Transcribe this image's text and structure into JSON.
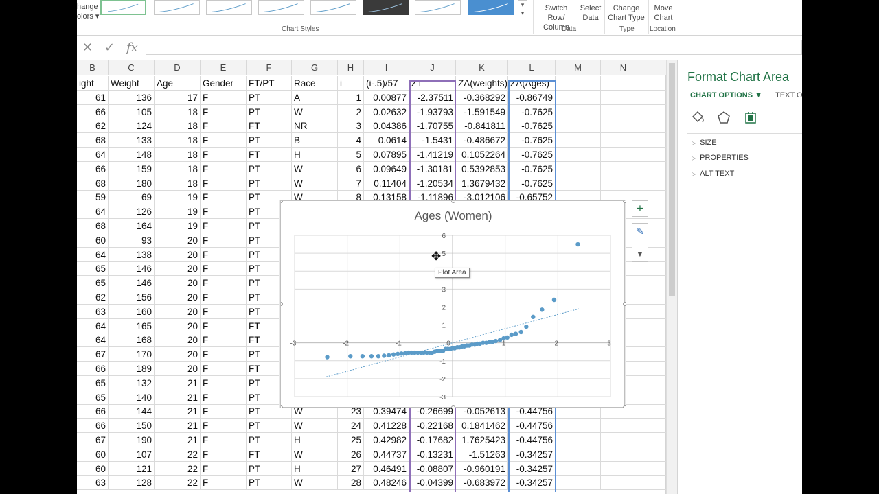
{
  "ribbon": {
    "change_colors_line1": "hange",
    "change_colors_line2": "olors ▾",
    "chart_styles_label": "Chart Styles",
    "switch_row_col": "Switch Row/\nColumn",
    "select_data": "Select\nData",
    "data_label": "Data",
    "change_chart_type": "Change\nChart Type",
    "type_label": "Type",
    "move_chart": "Move\nChart",
    "location_label": "Location"
  },
  "formula_bar": {
    "cancel_icon": "✕",
    "enter_icon": "✓",
    "fx_icon": "fx",
    "value": ""
  },
  "columns": [
    "B",
    "C",
    "D",
    "E",
    "F",
    "G",
    "H",
    "I",
    "J",
    "K",
    "L",
    "M",
    "N"
  ],
  "header_row": [
    "ight",
    "Weight",
    "Age",
    "Gender",
    "FT/PT",
    "Race",
    "i",
    "(i-.5)/57",
    "ZT",
    "ZA(weights)",
    "ZA(Ages)",
    "",
    ""
  ],
  "rows": [
    [
      "61",
      "136",
      "17",
      "F",
      "PT",
      "A",
      "1",
      "0.00877",
      "-2.37511",
      "-0.368292",
      "-0.86749"
    ],
    [
      "66",
      "105",
      "18",
      "F",
      "PT",
      "W",
      "2",
      "0.02632",
      "-1.93793",
      "-1.591549",
      "-0.7625"
    ],
    [
      "62",
      "124",
      "18",
      "F",
      "FT",
      "NR",
      "3",
      "0.04386",
      "-1.70755",
      "-0.841811",
      "-0.7625"
    ],
    [
      "68",
      "133",
      "18",
      "F",
      "PT",
      "B",
      "4",
      "0.0614",
      "-1.5431",
      "-0.486672",
      "-0.7625"
    ],
    [
      "64",
      "148",
      "18",
      "F",
      "FT",
      "H",
      "5",
      "0.07895",
      "-1.41219",
      "0.1052264",
      "-0.7625"
    ],
    [
      "66",
      "159",
      "18",
      "F",
      "PT",
      "W",
      "6",
      "0.09649",
      "-1.30181",
      "0.5392853",
      "-0.7625"
    ],
    [
      "68",
      "180",
      "18",
      "F",
      "PT",
      "W",
      "7",
      "0.11404",
      "-1.20534",
      "1.3679432",
      "-0.7625"
    ],
    [
      "59",
      "69",
      "19",
      "F",
      "PT",
      "W",
      "8",
      "0.13158",
      "-1.11896",
      "-3.012106",
      "-0.65752"
    ],
    [
      "64",
      "126",
      "19",
      "F",
      "PT",
      "",
      "",
      "",
      "",
      "",
      ""
    ],
    [
      "68",
      "164",
      "19",
      "F",
      "PT",
      "",
      "",
      "",
      "",
      "",
      ""
    ],
    [
      "60",
      "93",
      "20",
      "F",
      "PT",
      "",
      "",
      "",
      "",
      "",
      ""
    ],
    [
      "64",
      "138",
      "20",
      "F",
      "PT",
      "",
      "",
      "",
      "",
      "",
      ""
    ],
    [
      "65",
      "146",
      "20",
      "F",
      "PT",
      "",
      "",
      "",
      "",
      "",
      ""
    ],
    [
      "65",
      "146",
      "20",
      "F",
      "PT",
      "",
      "",
      "",
      "",
      "",
      ""
    ],
    [
      "62",
      "156",
      "20",
      "F",
      "PT",
      "",
      "",
      "",
      "",
      "",
      ""
    ],
    [
      "63",
      "160",
      "20",
      "F",
      "PT",
      "",
      "",
      "",
      "",
      "",
      ""
    ],
    [
      "64",
      "165",
      "20",
      "F",
      "FT",
      "",
      "",
      "",
      "",
      "",
      ""
    ],
    [
      "64",
      "168",
      "20",
      "F",
      "FT",
      "",
      "",
      "",
      "",
      "",
      ""
    ],
    [
      "67",
      "170",
      "20",
      "F",
      "PT",
      "",
      "",
      "",
      "",
      "",
      ""
    ],
    [
      "66",
      "189",
      "20",
      "F",
      "FT",
      "",
      "",
      "",
      "",
      "",
      ""
    ],
    [
      "65",
      "132",
      "21",
      "F",
      "PT",
      "",
      "",
      "",
      "",
      "",
      ""
    ],
    [
      "65",
      "140",
      "21",
      "F",
      "PT",
      "",
      "",
      "",
      "",
      "",
      ""
    ],
    [
      "66",
      "144",
      "21",
      "F",
      "PT",
      "W",
      "23",
      "0.39474",
      "-0.26699",
      "-0.052613",
      "-0.44756"
    ],
    [
      "66",
      "150",
      "21",
      "F",
      "PT",
      "W",
      "24",
      "0.41228",
      "-0.22168",
      "0.1841462",
      "-0.44756"
    ],
    [
      "67",
      "190",
      "21",
      "F",
      "PT",
      "H",
      "25",
      "0.42982",
      "-0.17682",
      "1.7625423",
      "-0.44756"
    ],
    [
      "60",
      "107",
      "22",
      "F",
      "FT",
      "W",
      "26",
      "0.44737",
      "-0.13231",
      "-1.51263",
      "-0.34257"
    ],
    [
      "60",
      "121",
      "22",
      "F",
      "PT",
      "H",
      "27",
      "0.46491",
      "-0.08807",
      "-0.960191",
      "-0.34257"
    ],
    [
      "63",
      "128",
      "22",
      "F",
      "PT",
      "W",
      "28",
      "0.48246",
      "-0.04399",
      "-0.683972",
      "-0.34257"
    ]
  ],
  "chart_data": {
    "type": "scatter",
    "title": "Ages (Women)",
    "xlim": [
      -3,
      3
    ],
    "ylim": [
      -3,
      6
    ],
    "x_ticks": [
      "-3",
      "-2",
      "-1",
      "0",
      "1",
      "2",
      "3"
    ],
    "y_ticks": [
      "6",
      "5",
      "4",
      "3",
      "2",
      "1",
      "0",
      "-1",
      "-2",
      "-3"
    ],
    "grid": true,
    "trendline": {
      "from": [
        -2.4,
        -1.9
      ],
      "to": [
        2.4,
        1.9
      ]
    },
    "points": [
      [
        -2.38,
        -0.8
      ],
      [
        -1.94,
        -0.75
      ],
      [
        -1.71,
        -0.75
      ],
      [
        -1.54,
        -0.75
      ],
      [
        -1.41,
        -0.75
      ],
      [
        -1.3,
        -0.72
      ],
      [
        -1.21,
        -0.7
      ],
      [
        -1.12,
        -0.65
      ],
      [
        -1.04,
        -0.62
      ],
      [
        -0.97,
        -0.6
      ],
      [
        -0.9,
        -0.58
      ],
      [
        -0.84,
        -0.55
      ],
      [
        -0.78,
        -0.55
      ],
      [
        -0.72,
        -0.55
      ],
      [
        -0.66,
        -0.55
      ],
      [
        -0.6,
        -0.55
      ],
      [
        -0.55,
        -0.55
      ],
      [
        -0.49,
        -0.55
      ],
      [
        -0.44,
        -0.55
      ],
      [
        -0.39,
        -0.55
      ],
      [
        -0.34,
        -0.5
      ],
      [
        -0.29,
        -0.45
      ],
      [
        -0.27,
        -0.45
      ],
      [
        -0.22,
        -0.45
      ],
      [
        -0.18,
        -0.45
      ],
      [
        -0.13,
        -0.34
      ],
      [
        -0.09,
        -0.34
      ],
      [
        -0.04,
        -0.34
      ],
      [
        0.0,
        -0.3
      ],
      [
        0.04,
        -0.3
      ],
      [
        0.09,
        -0.25
      ],
      [
        0.13,
        -0.25
      ],
      [
        0.18,
        -0.2
      ],
      [
        0.22,
        -0.2
      ],
      [
        0.27,
        -0.15
      ],
      [
        0.32,
        -0.15
      ],
      [
        0.37,
        -0.1
      ],
      [
        0.42,
        -0.1
      ],
      [
        0.47,
        -0.05
      ],
      [
        0.52,
        -0.05
      ],
      [
        0.58,
        0.0
      ],
      [
        0.64,
        0.0
      ],
      [
        0.7,
        0.05
      ],
      [
        0.76,
        0.05
      ],
      [
        0.82,
        0.1
      ],
      [
        0.9,
        0.15
      ],
      [
        0.97,
        0.25
      ],
      [
        1.04,
        0.3
      ],
      [
        1.12,
        0.45
      ],
      [
        1.2,
        0.5
      ],
      [
        1.3,
        0.6
      ],
      [
        1.4,
        0.9
      ],
      [
        1.53,
        1.45
      ],
      [
        1.7,
        1.85
      ],
      [
        1.93,
        2.4
      ],
      [
        2.38,
        5.5
      ]
    ]
  },
  "chart_tools": {
    "add_elements": "+",
    "styles": "✎",
    "filter": "▼"
  },
  "tooltip": "Plot Area",
  "cursor": "✥",
  "pane": {
    "title": "Format Chart Area",
    "tab_chart": "CHART OPTIONS ▼",
    "tab_text": "TEXT OPTIO",
    "sections": [
      "SIZE",
      "PROPERTIES",
      "ALT TEXT"
    ]
  },
  "colors": {
    "accent": "#217346",
    "point": "#5b9bc8",
    "grid": "#d9d9d9"
  }
}
